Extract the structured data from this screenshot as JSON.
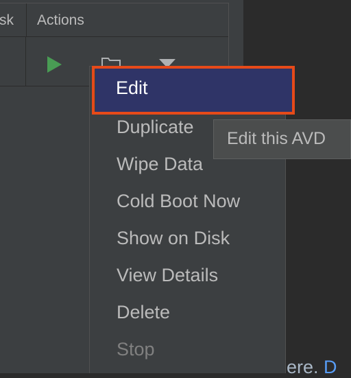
{
  "table": {
    "disk_header": "sk",
    "actions_header": "Actions"
  },
  "row_icons": [
    "play-icon",
    "folder-icon",
    "dropdown-arrow-icon"
  ],
  "menu": {
    "items": [
      {
        "label": "Edit",
        "highlighted": true
      },
      {
        "label": "Duplicate"
      },
      {
        "label": "Wipe Data"
      },
      {
        "label": "Cold Boot Now"
      },
      {
        "label": "Show on Disk"
      },
      {
        "label": "View Details"
      },
      {
        "label": "Delete"
      },
      {
        "label": "Stop",
        "disabled": true
      }
    ]
  },
  "tooltip": {
    "text": "Edit this AVD"
  },
  "background_text": {
    "before": "ere.",
    "link": "D"
  },
  "colors": {
    "panel": "#3c3f41",
    "editor": "#2b2b2b",
    "highlight": "#2f3467",
    "annotation": "#e64a19",
    "play": "#499c54",
    "link": "#589df6"
  }
}
